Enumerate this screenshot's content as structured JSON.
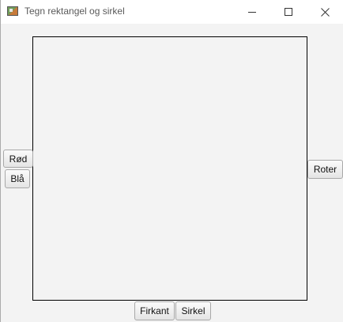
{
  "window": {
    "title": "Tegn rektangel og sirkel",
    "app_icon": "app-icon",
    "controls": [
      "minimize-icon",
      "maximize-icon",
      "close-icon"
    ]
  },
  "buttons": {
    "red": "Rød",
    "blue": "Blå",
    "rotate": "Roter",
    "square": "Firkant",
    "circle": "Sirkel"
  }
}
